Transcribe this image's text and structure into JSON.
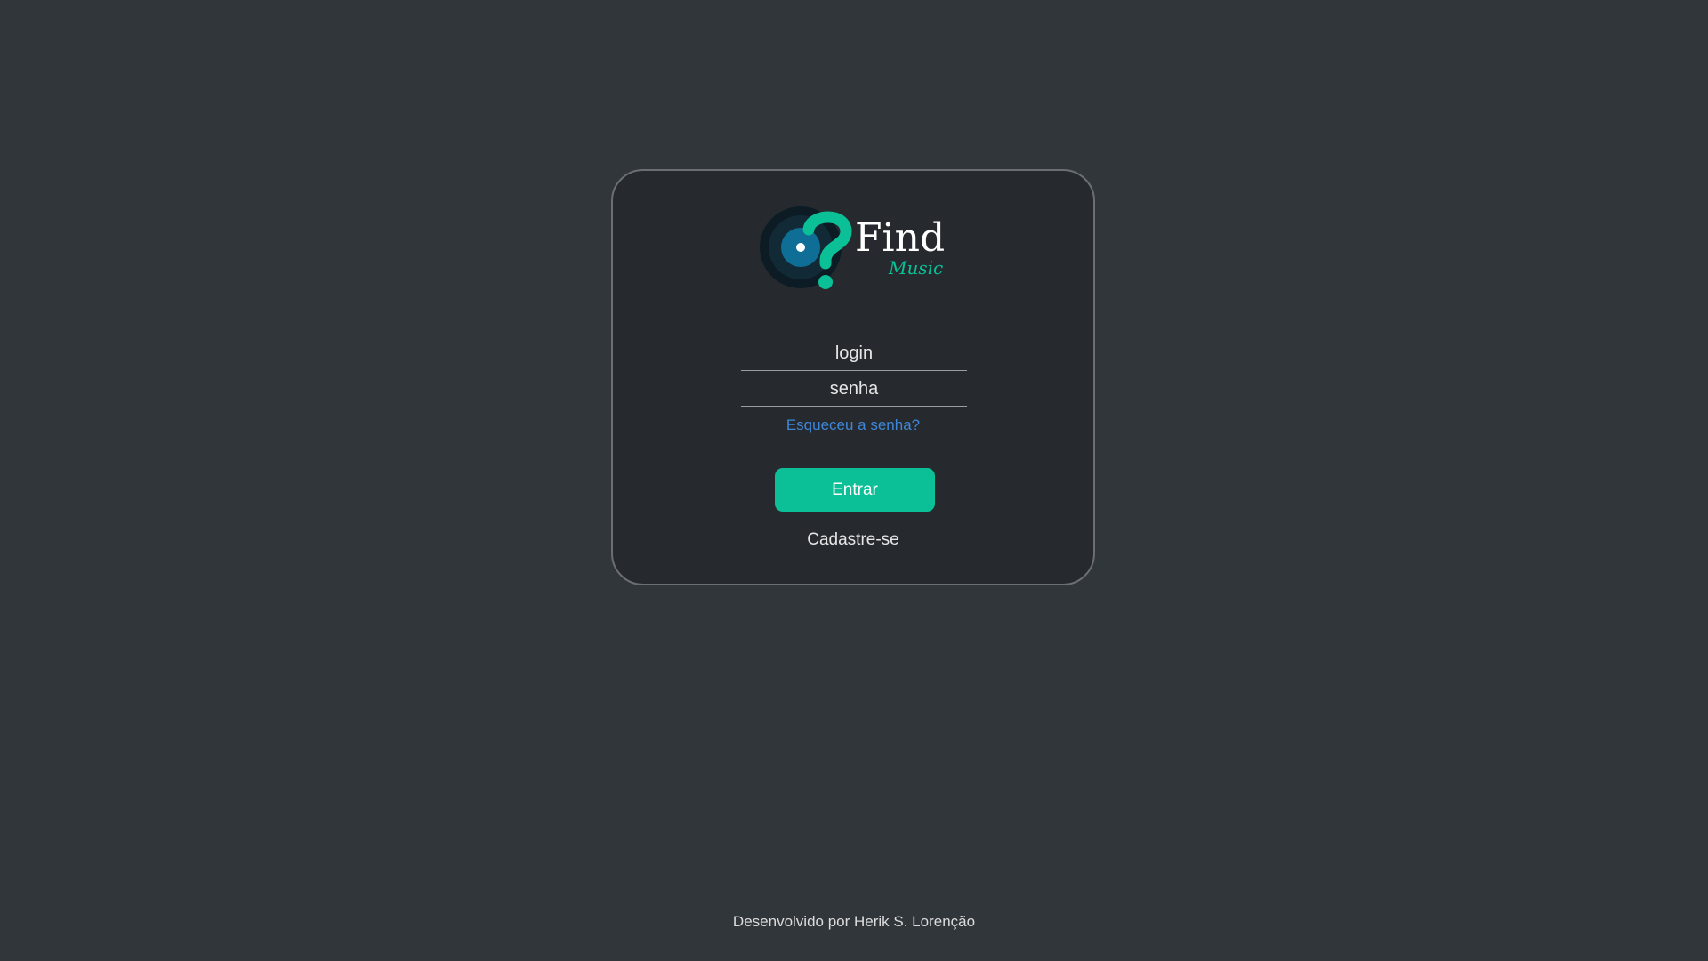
{
  "brand": {
    "title": "Find",
    "subtitle": "Music",
    "icon": "vinyl-question-mark-logo",
    "accent_color": "#0bbf96",
    "disc_color": "#0f6e96"
  },
  "form": {
    "login_placeholder": "login",
    "password_placeholder": "senha",
    "login_value": "",
    "password_value": "",
    "forgot_label": "Esqueceu a senha?",
    "submit_label": "Entrar",
    "signup_label": "Cadastre-se"
  },
  "footer": {
    "text": "Desenvolvido por Herik S. Lorenção"
  },
  "colors": {
    "background": "#31363b",
    "card": "#262a2e",
    "link": "#3f86d6",
    "button": "#0bbf96"
  }
}
